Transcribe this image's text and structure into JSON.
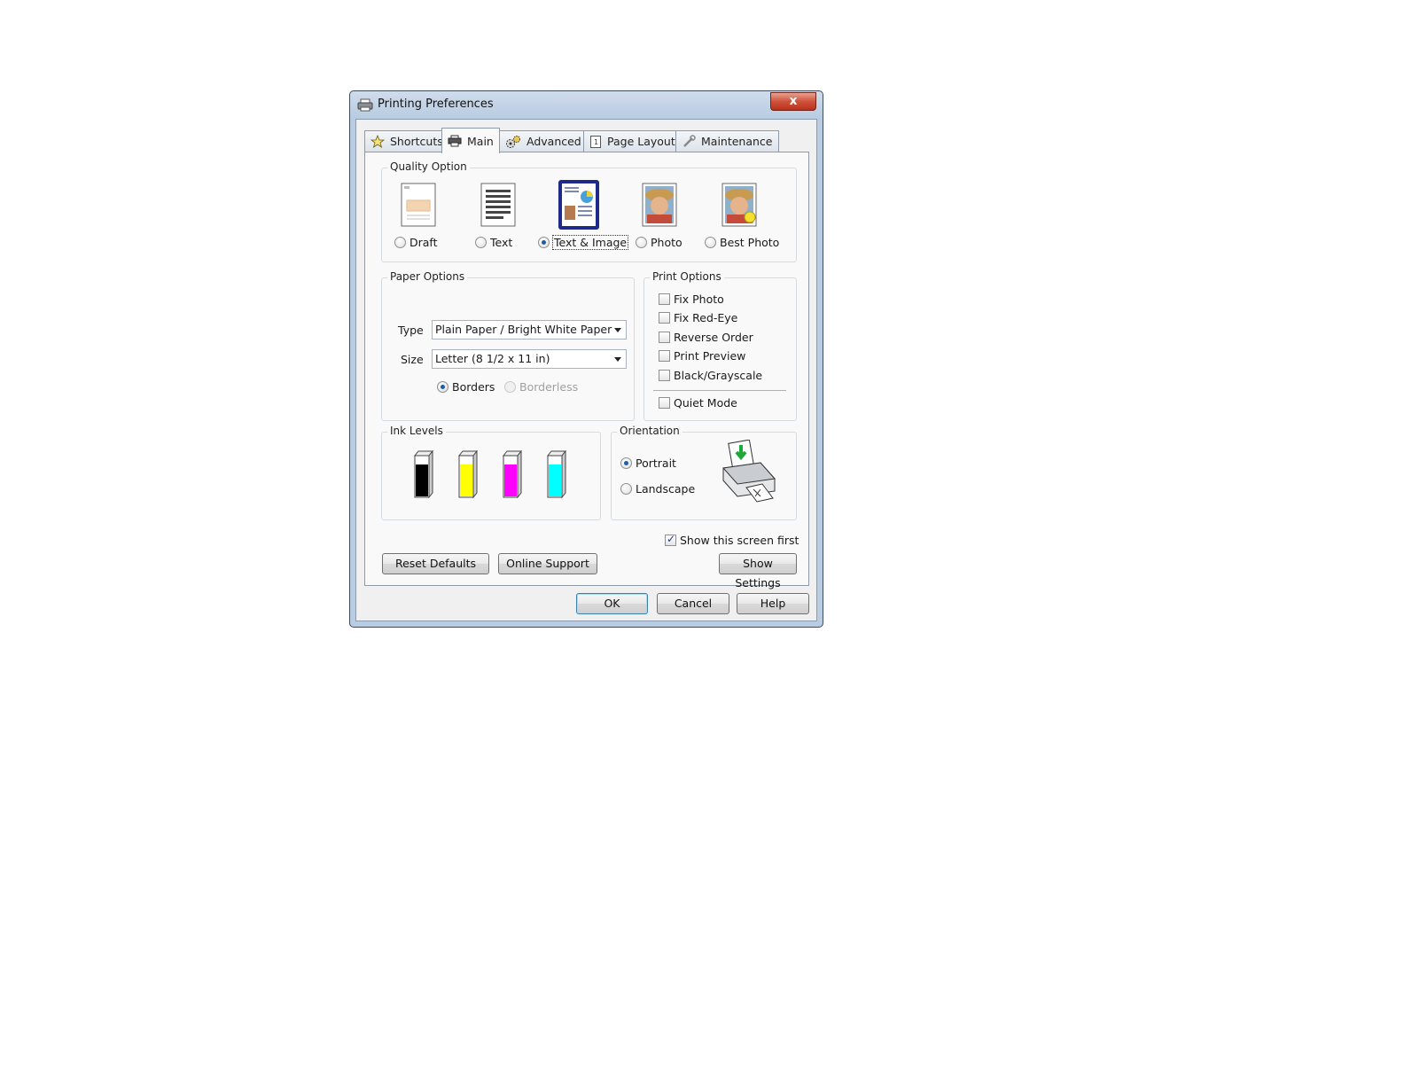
{
  "window": {
    "title": "Printing Preferences",
    "close_glyph": "x"
  },
  "tabs": [
    {
      "label": "Shortcuts",
      "icon": "star-icon",
      "active": false
    },
    {
      "label": "Main",
      "icon": "printer-icon",
      "active": true
    },
    {
      "label": "Advanced",
      "icon": "gears-icon",
      "active": false
    },
    {
      "label": "Page Layout",
      "icon": "page-icon",
      "active": false
    },
    {
      "label": "Maintenance",
      "icon": "wrench-icon",
      "active": false
    }
  ],
  "quality_option": {
    "title": "Quality Option",
    "options": [
      {
        "label": "Draft",
        "selected": false,
        "icon": "draft-page-icon"
      },
      {
        "label": "Text",
        "selected": false,
        "icon": "text-page-icon"
      },
      {
        "label": "Text & Image",
        "selected": true,
        "icon": "text-image-page-icon"
      },
      {
        "label": "Photo",
        "selected": false,
        "icon": "photo-icon"
      },
      {
        "label": "Best Photo",
        "selected": false,
        "icon": "best-photo-icon"
      }
    ]
  },
  "paper_options": {
    "title": "Paper Options",
    "type_label": "Type",
    "type_value": "Plain Paper / Bright White Paper",
    "size_label": "Size",
    "size_value": "Letter (8 1/2 x 11 in)",
    "borders_label": "Borders",
    "borderless_label": "Borderless",
    "borders_selected": true,
    "borderless_enabled": false
  },
  "print_options": {
    "title": "Print Options",
    "items": [
      {
        "label": "Fix Photo",
        "checked": false
      },
      {
        "label": "Fix Red-Eye",
        "checked": false
      },
      {
        "label": "Reverse Order",
        "checked": false
      },
      {
        "label": "Print Preview",
        "checked": false
      },
      {
        "label": "Black/Grayscale",
        "checked": false
      }
    ],
    "quiet_mode_label": "Quiet Mode",
    "quiet_mode_checked": false
  },
  "ink_levels": {
    "title": "Ink Levels",
    "cartridges": [
      {
        "color": "#000000",
        "level": 0.8
      },
      {
        "color": "#ffff00",
        "level": 0.8
      },
      {
        "color": "#ff00ff",
        "level": 0.8
      },
      {
        "color": "#00ffff",
        "level": 0.8
      }
    ]
  },
  "orientation": {
    "title": "Orientation",
    "portrait_label": "Portrait",
    "landscape_label": "Landscape",
    "selected": "portrait",
    "preview_icon": "printer-portrait-icon"
  },
  "show_screen_first": {
    "label": "Show this screen first",
    "checked": true
  },
  "buttons": {
    "reset_defaults": "Reset Defaults",
    "online_support": "Online Support",
    "show_settings": "Show Settings",
    "ok": "OK",
    "cancel": "Cancel",
    "help": "Help"
  }
}
